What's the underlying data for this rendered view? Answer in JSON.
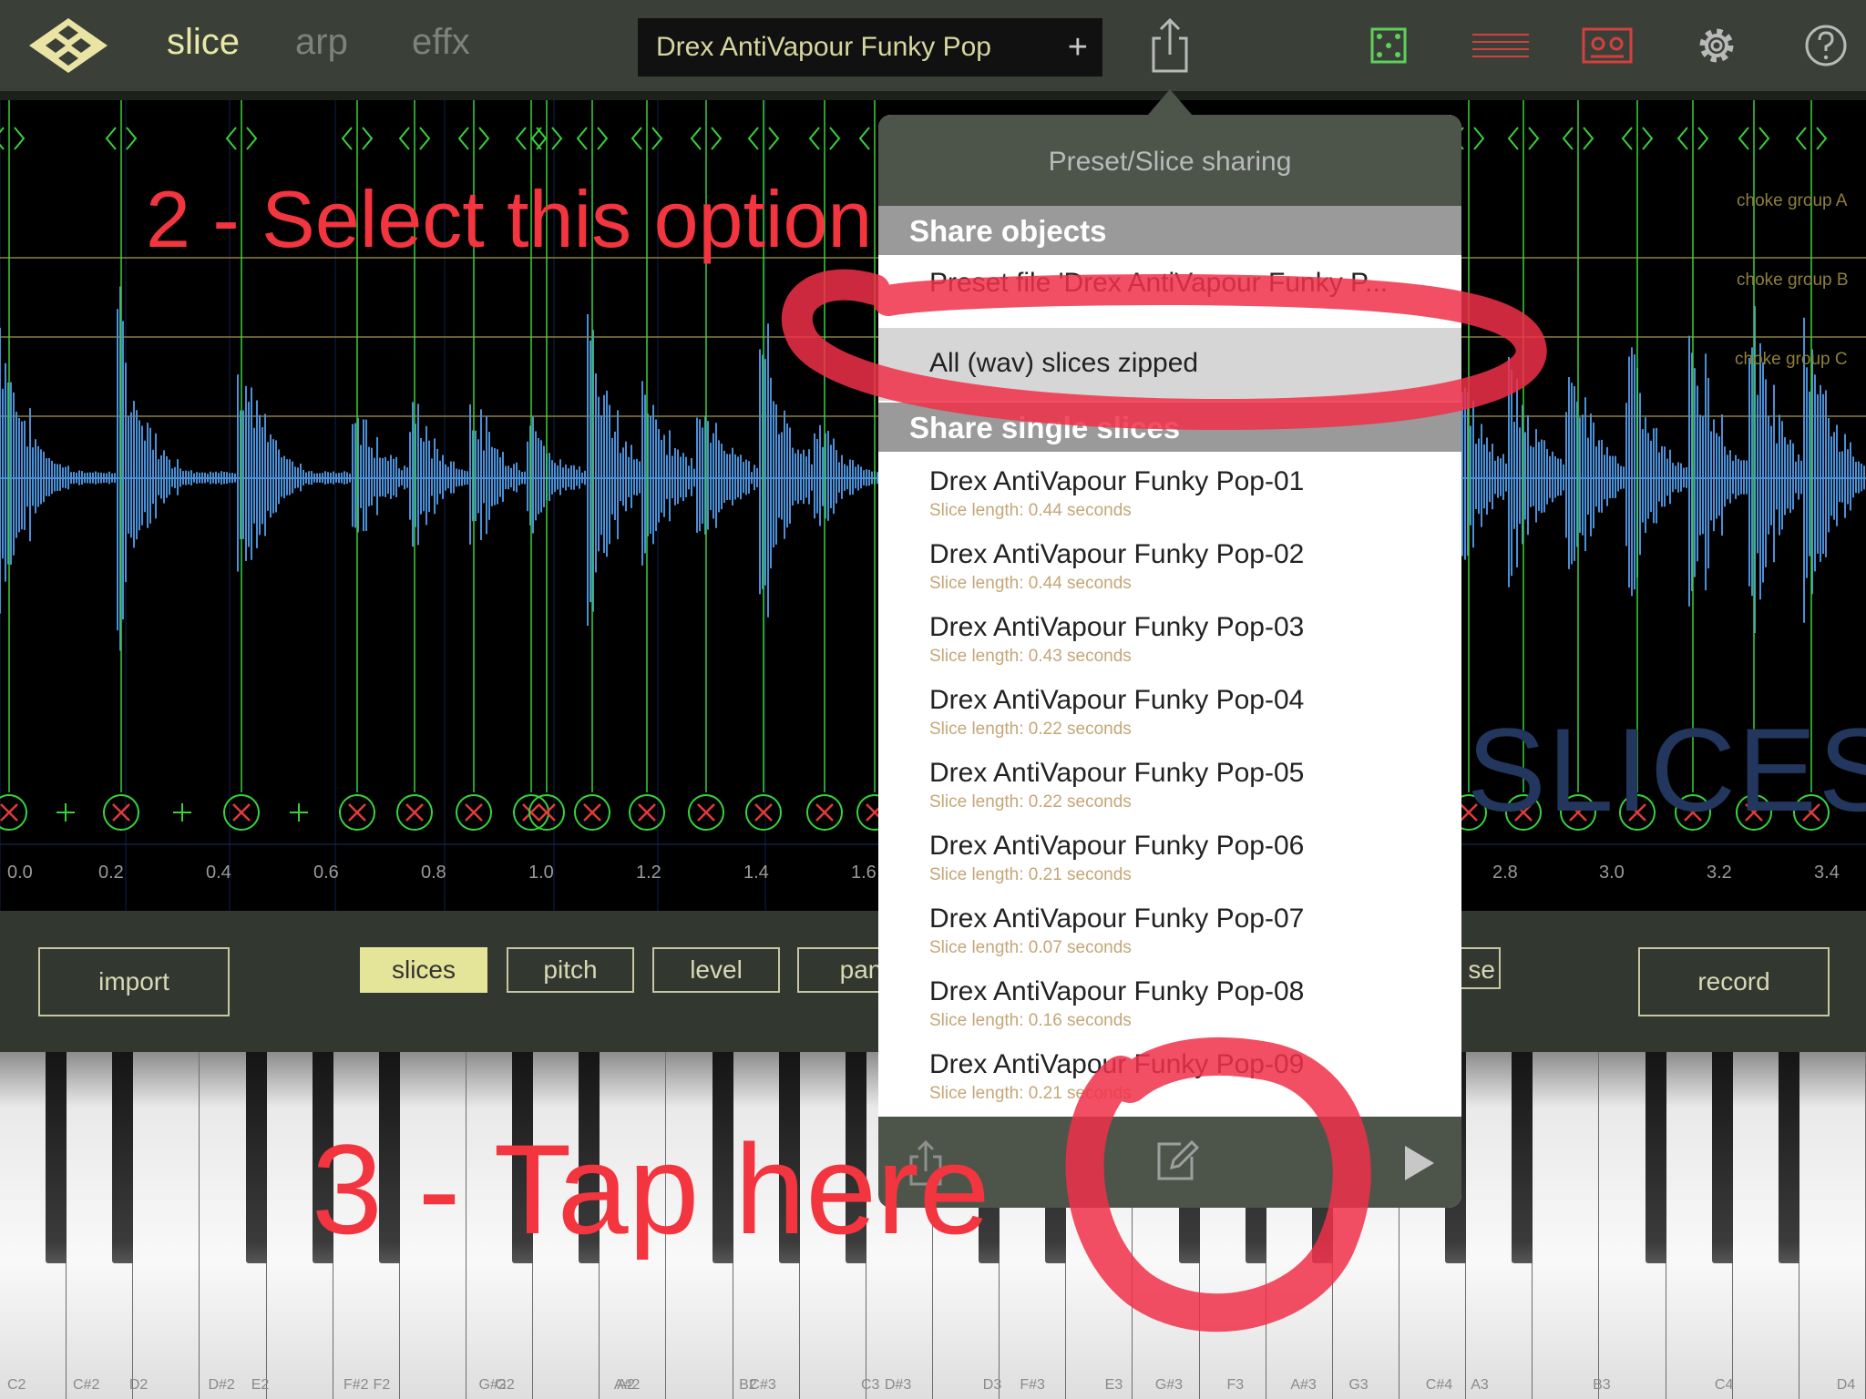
{
  "topbar": {
    "tabs": [
      "slice",
      "arp",
      "effx"
    ],
    "active_tab": "slice",
    "preset_name": "Drex AntiVapour Funky Pop",
    "preset_add": "+",
    "icons": [
      "logo-icon",
      "share-icon",
      "dice-icon",
      "lines-icon",
      "tape-icon",
      "gear-icon",
      "help-icon"
    ]
  },
  "waveform": {
    "choke_groups": [
      "choke group A",
      "choke group B",
      "choke group C"
    ],
    "ticks": [
      "0.0",
      "0.2",
      "0.4",
      "0.6",
      "0.8",
      "1.0",
      "1.2",
      "1.4",
      "1.6",
      "2.8",
      "3.0",
      "3.2",
      "3.4"
    ],
    "watermark": "SLICES"
  },
  "controls": {
    "import": "import",
    "slices": "slices",
    "pitch": "pitch",
    "level": "level",
    "pan_partial": "pan",
    "right_partial": "se",
    "record": "record"
  },
  "popover": {
    "title": "Preset/Slice sharing",
    "section_objects": "Share objects",
    "preset_file": "Preset file 'Drex AntiVapour Funky P...",
    "zip_option": "All (wav) slices zipped",
    "section_single": "Share single slices",
    "slices": [
      {
        "name": "Drex AntiVapour Funky Pop-01",
        "length": "Slice length: 0.44 seconds"
      },
      {
        "name": "Drex AntiVapour Funky Pop-02",
        "length": "Slice length: 0.44 seconds"
      },
      {
        "name": "Drex AntiVapour Funky Pop-03",
        "length": "Slice length: 0.43 seconds"
      },
      {
        "name": "Drex AntiVapour Funky Pop-04",
        "length": "Slice length: 0.22 seconds"
      },
      {
        "name": "Drex AntiVapour Funky Pop-05",
        "length": "Slice length: 0.22 seconds"
      },
      {
        "name": "Drex AntiVapour Funky Pop-06",
        "length": "Slice length: 0.21 seconds"
      },
      {
        "name": "Drex AntiVapour Funky Pop-07",
        "length": "Slice length: 0.07 seconds"
      },
      {
        "name": "Drex AntiVapour Funky Pop-08",
        "length": "Slice length: 0.16 seconds"
      },
      {
        "name": "Drex AntiVapour Funky Pop-09",
        "length": "Slice length: 0.21 seconds"
      }
    ],
    "footer_icons": [
      "share-icon",
      "edit-icon",
      "play-icon"
    ]
  },
  "annotations": {
    "step2": "2 - Select this option",
    "step3": "3 - Tap here"
  },
  "piano": {
    "white_keys": [
      "C2",
      "D2",
      "E2",
      "F2",
      "G2",
      "A2",
      "B2",
      "C3",
      "D3",
      "E3",
      "F3",
      "G3",
      "A3",
      "B3",
      "C4",
      "D4"
    ],
    "sharp_labels": [
      "C#2",
      "D#2",
      "F#2",
      "G#2",
      "A#2",
      "C#3",
      "D#3",
      "F#3",
      "G#3",
      "A#3",
      "C#4"
    ]
  },
  "colors": {
    "accent_yellow": "#e5e59a",
    "slice_marker": "#37d33c",
    "waveform": "#4b8fd6",
    "annotation_red": "#f2353f"
  }
}
